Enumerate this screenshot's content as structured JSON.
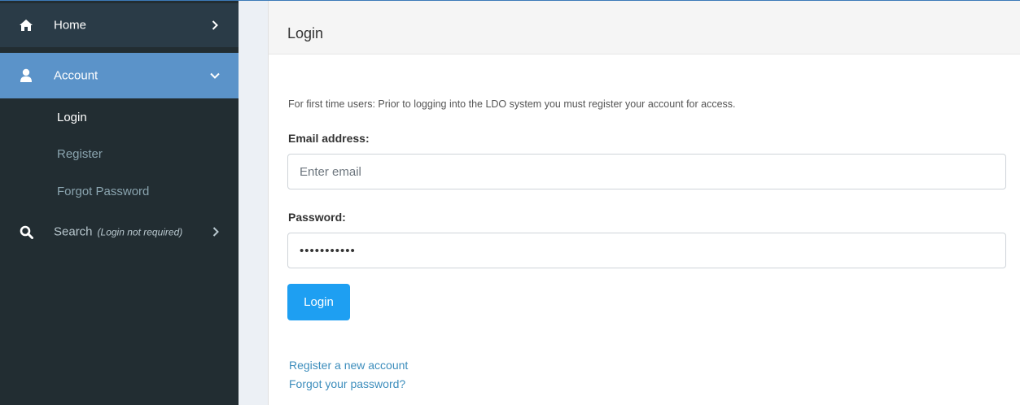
{
  "sidebar": {
    "home_label": "Home",
    "account_label": "Account",
    "sub_items": [
      {
        "label": "Login"
      },
      {
        "label": "Register"
      },
      {
        "label": "Forgot Password"
      }
    ],
    "search_label": "Search",
    "search_hint": "(Login not required)"
  },
  "panel": {
    "title": "Login",
    "intro": "For first time users: Prior to logging into the LDO system you must register your account for access.",
    "email_label": "Email address:",
    "email_placeholder": "Enter email",
    "email_value": "",
    "password_label": "Password:",
    "password_value": "•••••••••••",
    "login_button": "Login",
    "register_link": "Register a new account",
    "forgot_link": "Forgot your password?"
  },
  "colors": {
    "sidebar_bg": "#222d32",
    "active_nav_bg": "#5b93c9",
    "button_bg": "#1e9ff2",
    "link": "#3c8dbc"
  },
  "icons": {
    "home": "home-icon",
    "account": "user-icon",
    "search": "search-icon"
  }
}
